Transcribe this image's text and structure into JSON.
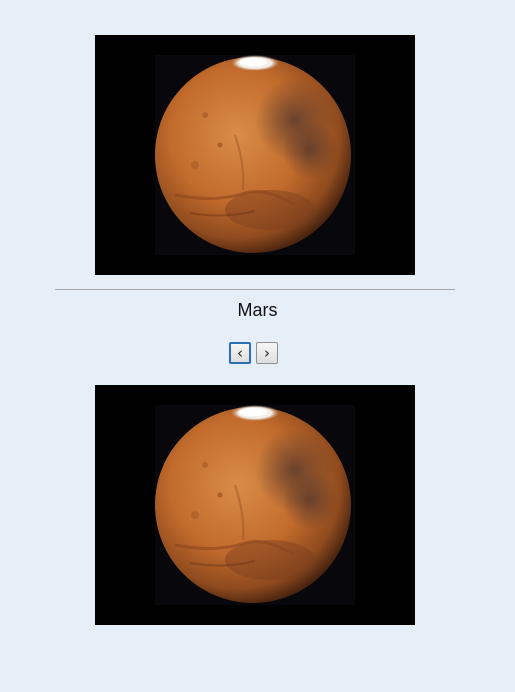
{
  "caption": "Mars",
  "image_subject": "mars-globe",
  "colors": {
    "page_background": "#e6eef8",
    "photo_background": "#000000",
    "planet_base": "#c06a28",
    "focus_ring": "#2a6fb8"
  },
  "nav": {
    "prev_label": "‹",
    "next_label": "›",
    "prev_icon": "chevron-left-icon",
    "next_icon": "chevron-right-icon",
    "focused": "prev"
  }
}
